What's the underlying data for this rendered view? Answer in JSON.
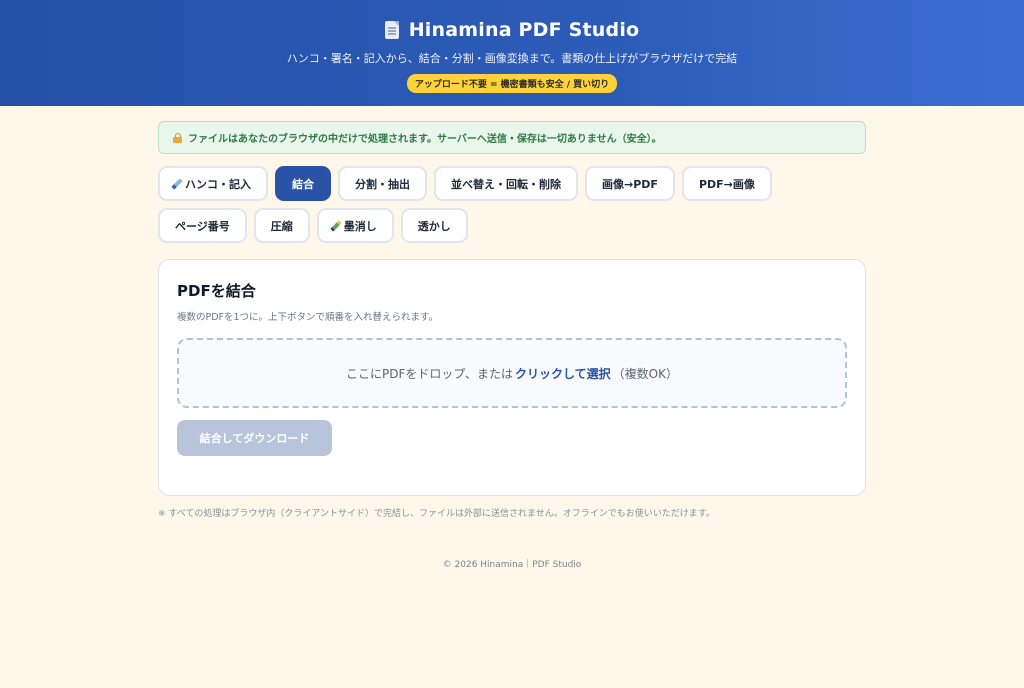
{
  "header": {
    "title": "Hinamina PDF Studio",
    "subtitle": "ハンコ・署名・記入から、結合・分割・画像変換まで。書類の仕上げがブラウザだけで完結",
    "badge": "アップロード不要 = 機密書類も安全 / 買い切り",
    "icon": "document-icon"
  },
  "notice": {
    "icon": "lock-icon",
    "text": "ファイルはあなたのブラウザの中だけで処理されます。サーバーへ送信・保存は一切ありません（安全）。"
  },
  "tabs": [
    {
      "label": "ハンコ・記入",
      "icon": "pen-icon",
      "active": false
    },
    {
      "label": "結合",
      "active": true
    },
    {
      "label": "分割・抽出",
      "active": false
    },
    {
      "label": "並べ替え・回転・削除",
      "active": false
    },
    {
      "label": "画像→PDF",
      "active": false
    },
    {
      "label": "PDF→画像",
      "active": false
    },
    {
      "label": "ページ番号",
      "active": false
    },
    {
      "label": "圧縮",
      "active": false
    },
    {
      "label": "墨消し",
      "icon": "marker-icon",
      "active": false
    },
    {
      "label": "透かし",
      "active": false
    }
  ],
  "card": {
    "title": "PDFを結合",
    "description": "複数のPDFを1つに。上下ボタンで順番を入れ替えられます。",
    "dropzone": {
      "prefix": "ここにPDFをドロップ、または",
      "link": "クリックして選択",
      "suffix": "（複数OK）"
    },
    "download_button": "結合してダウンロード"
  },
  "footnote": "※ すべての処理はブラウザ内（クライアントサイド）で完結し、ファイルは外部に送信されません。オフラインでもお使いいただけます。",
  "copyright": "© 2026 Hinamina｜PDF Studio",
  "colors": {
    "header": "#2d5cb8",
    "accent": "#2a53a8",
    "badge": "#ffd23a",
    "background": "#fff8ea",
    "notice_bg": "#e8f6ec"
  }
}
